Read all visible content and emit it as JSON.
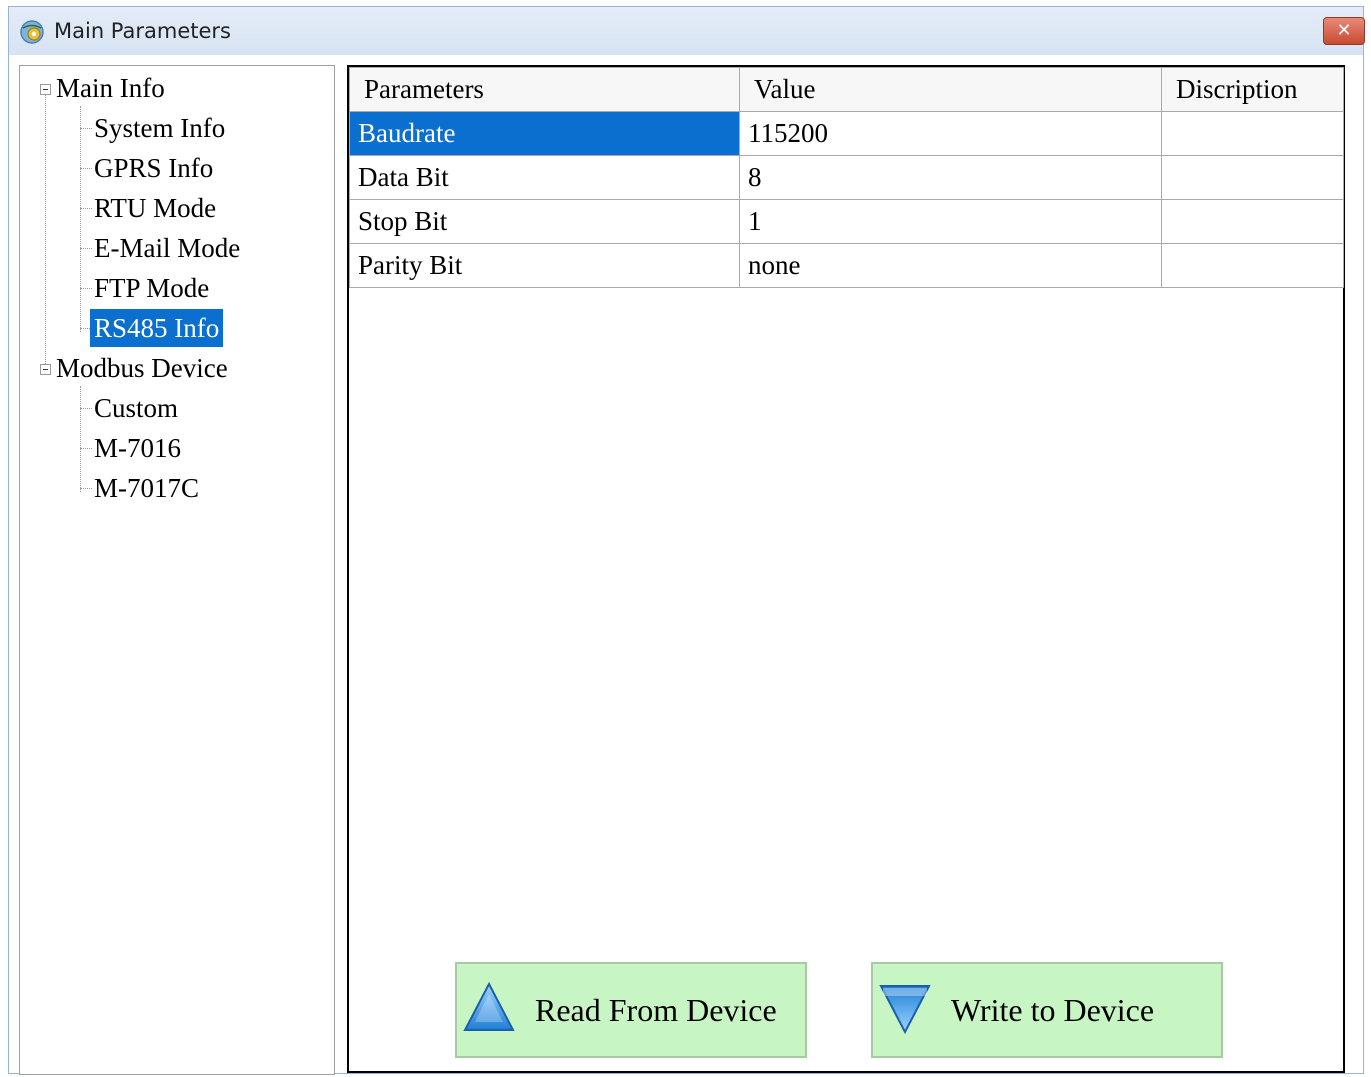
{
  "window": {
    "title": "Main Parameters",
    "close_label": "✕"
  },
  "tree": {
    "root_main": "Main Info",
    "main_children": [
      "System Info",
      "GPRS Info",
      "RTU Mode",
      "E-Mail Mode",
      "FTP Mode",
      "RS485 Info"
    ],
    "root_modbus": "Modbus Device",
    "modbus_children": [
      "Custom",
      "M-7016",
      "M-7017C"
    ],
    "selected": "RS485 Info"
  },
  "grid": {
    "headers": {
      "parameters": "Parameters",
      "value": "Value",
      "description": "Discription"
    },
    "rows": [
      {
        "parameter": "Baudrate",
        "value": "115200",
        "description": ""
      },
      {
        "parameter": "Data Bit",
        "value": "8",
        "description": ""
      },
      {
        "parameter": "Stop Bit",
        "value": "1",
        "description": ""
      },
      {
        "parameter": "Parity Bit",
        "value": "none",
        "description": ""
      }
    ],
    "selected_row": "Baudrate"
  },
  "actions": {
    "read_label": "Read From Device",
    "write_label": "Write to Device"
  },
  "colors": {
    "selection": "#0a6fce",
    "button_bg": "#c8f5c4",
    "arrow_blue": "#3aa0f0"
  },
  "icons": {
    "app": "network-gear-icon",
    "read": "up-arrow-icon",
    "write": "down-arrow-icon",
    "close": "close-icon"
  }
}
